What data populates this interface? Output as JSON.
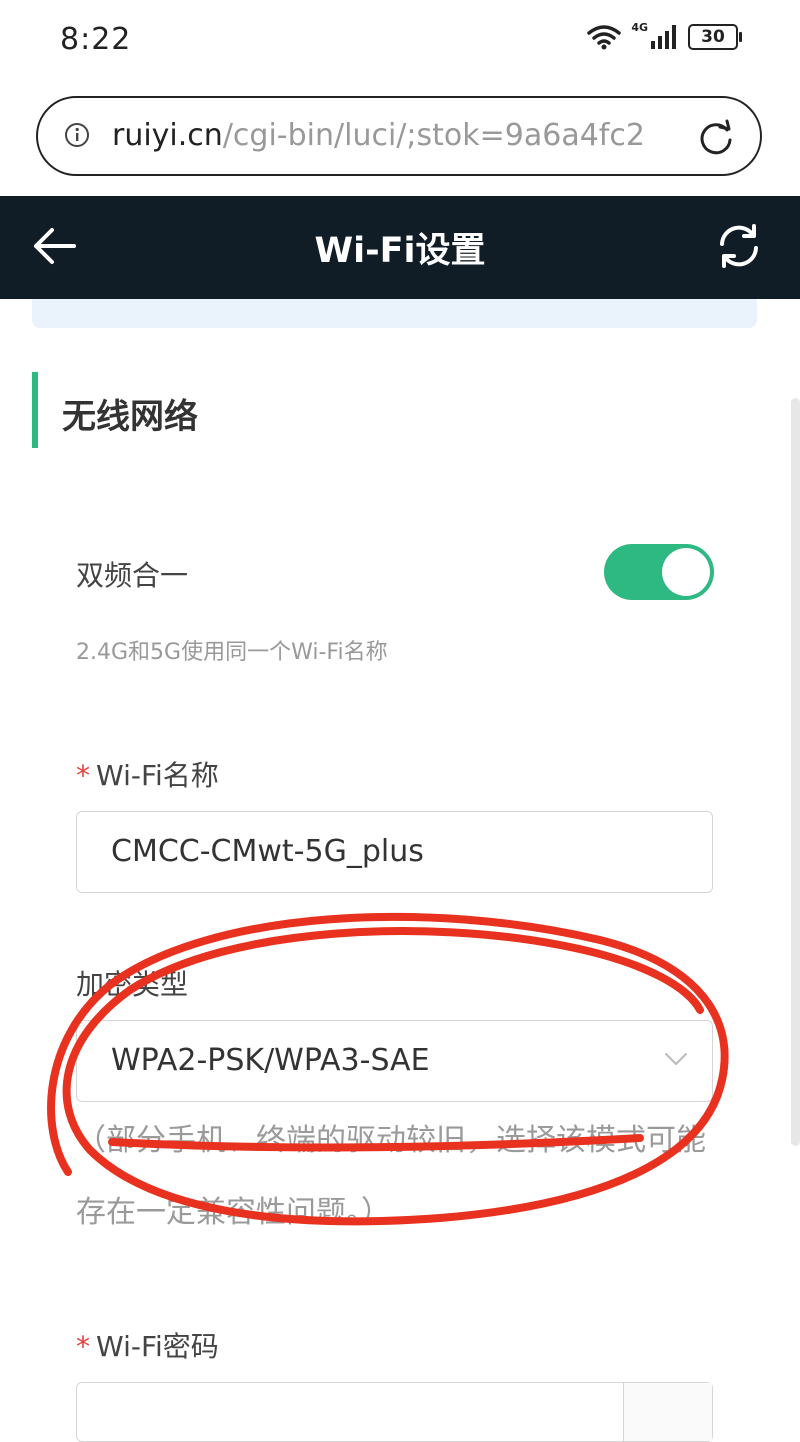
{
  "status_bar": {
    "time": "8:22",
    "network_label": "4G",
    "battery_level": "30"
  },
  "browser": {
    "url_host": "ruiyi.cn",
    "url_path": "/cgi-bin/luci/;stok=9a6a4fc2"
  },
  "header": {
    "title": "Wi-Fi设置"
  },
  "section": {
    "title": "无线网络"
  },
  "dual_band": {
    "label": "双频合一",
    "hint": "2.4G和5G使用同一个Wi-Fi名称",
    "enabled": true
  },
  "wifi_name": {
    "required_mark": "*",
    "label": "Wi-Fi名称",
    "value": "CMCC-CMwt-5G_plus"
  },
  "encryption": {
    "label": "加密类型",
    "value": "WPA2-PSK/WPA3-SAE",
    "note": "（部分手机、终端的驱动较旧，选择该模式可能存在一定兼容性问题。）"
  },
  "wifi_password": {
    "required_mark": "*",
    "label": "Wi-Fi密码",
    "value": ""
  },
  "colors": {
    "header_bg": "#101c26",
    "accent": "#2fb982",
    "required": "#e8403b",
    "annotation": "#e8321f"
  }
}
